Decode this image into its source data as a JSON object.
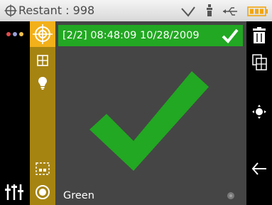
{
  "status": {
    "label": "Restant : 998",
    "icons": [
      "crosshair-icon",
      "wifi-icon",
      "usb-device-icon",
      "usb-icon",
      "battery-icon"
    ]
  },
  "left": {
    "icons": [
      "menu-dots-icon",
      "sliders-icon"
    ]
  },
  "toolbar": {
    "icons": [
      "target-icon",
      "grid-icon",
      "lightbulb-icon",
      "region-select-icon",
      "record-icon"
    ],
    "active": "target-icon"
  },
  "result": {
    "header": "[2/2] 08:48:09 10/28/2009",
    "status": "pass",
    "sample_name": "Green"
  },
  "right": {
    "icons": [
      "trash-icon",
      "compare-icon",
      "measure-icon",
      "back-arrow-icon"
    ]
  },
  "colors": {
    "pass_green": "#22a822",
    "toolbar_gold": "#a68412",
    "toolbar_active": "#f2b01a",
    "panel_gray": "#454545"
  }
}
